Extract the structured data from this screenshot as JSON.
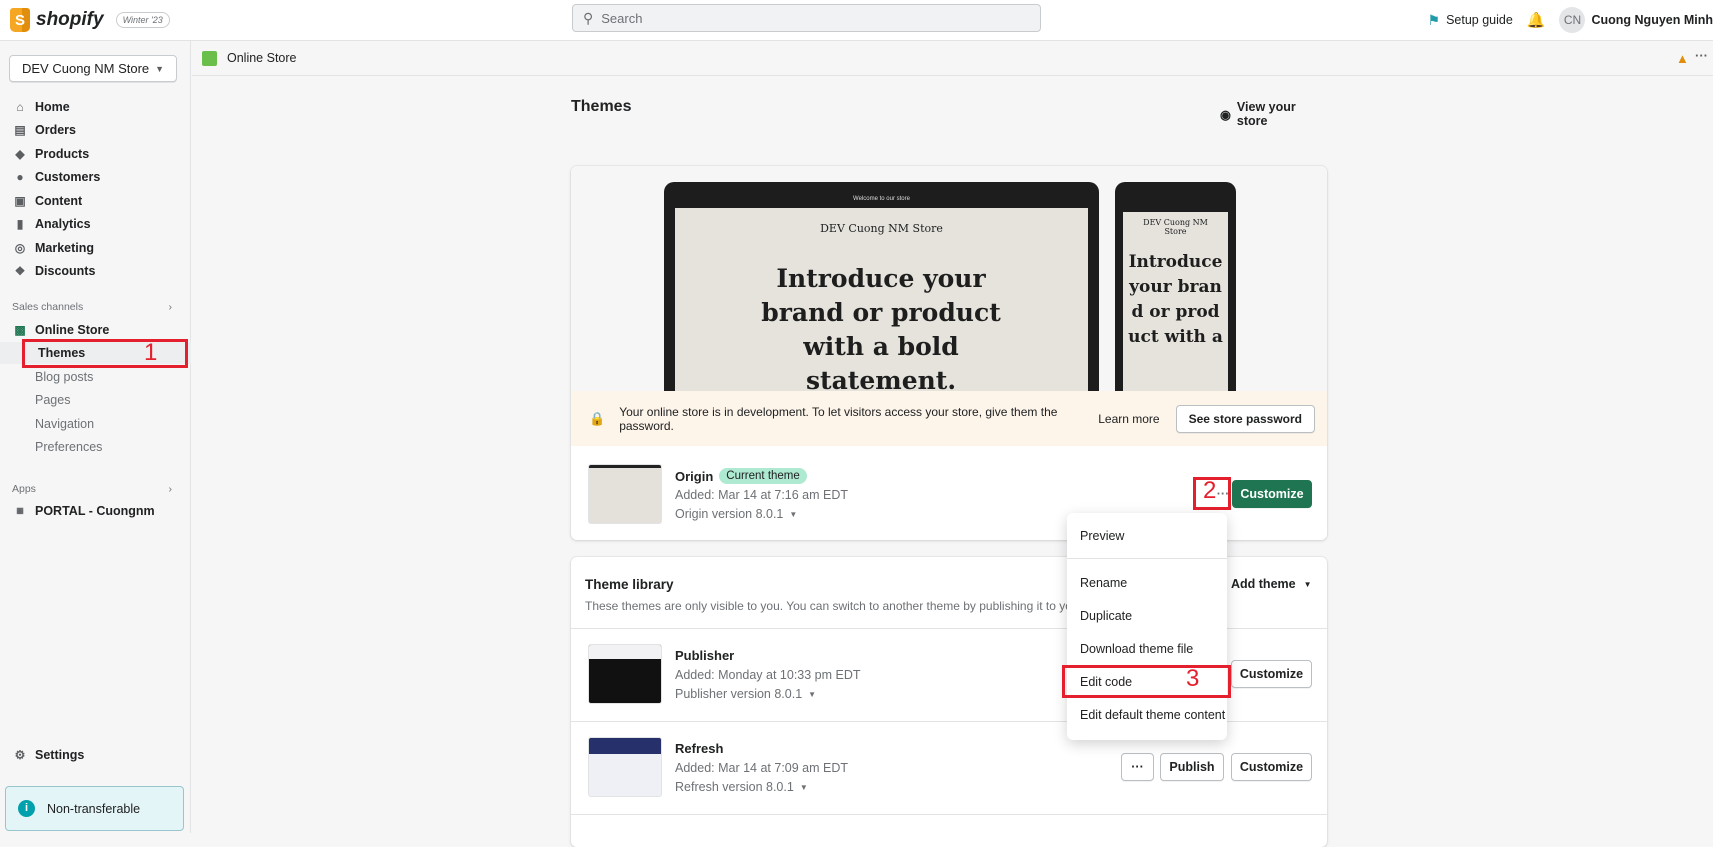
{
  "topbar": {
    "brand": "shopify",
    "version_badge": "Winter '23",
    "search_placeholder": "Search",
    "setup_guide": "Setup guide",
    "avatar_initials": "CN",
    "user_name": "Cuong Nguyen Minh"
  },
  "sidebar": {
    "store_name": "DEV Cuong NM Store",
    "nav": [
      {
        "label": "Home",
        "icon": "home-icon"
      },
      {
        "label": "Orders",
        "icon": "orders-icon"
      },
      {
        "label": "Products",
        "icon": "tag-icon"
      },
      {
        "label": "Customers",
        "icon": "person-icon"
      },
      {
        "label": "Content",
        "icon": "content-icon"
      },
      {
        "label": "Analytics",
        "icon": "chart-icon"
      },
      {
        "label": "Marketing",
        "icon": "target-icon"
      },
      {
        "label": "Discounts",
        "icon": "discount-icon"
      }
    ],
    "sales_channels_label": "Sales channels",
    "online_store": "Online Store",
    "sub_items": [
      "Themes",
      "Blog posts",
      "Pages",
      "Navigation",
      "Preferences"
    ],
    "apps_label": "Apps",
    "app_item": "PORTAL - Cuongnm",
    "settings": "Settings",
    "non_transferable": "Non-transferable"
  },
  "breadcrumb": {
    "label": "Online Store"
  },
  "page": {
    "title": "Themes",
    "view_store": "View your store"
  },
  "preview": {
    "announcement": "Welcome to our store",
    "store_title": "DEV Cuong NM Store",
    "store_title_mobile": "DEV Cuong NM Store",
    "headline": "Introduce your brand or product with a bold statement.",
    "headline_mobile": "Introduce your brand or product with a"
  },
  "banner": {
    "text": "Your online store is in development. To let visitors access your store, give them the password.",
    "learn_more": "Learn more",
    "button": "See store password"
  },
  "current_theme": {
    "name": "Origin",
    "badge": "Current theme",
    "added": "Added: Mar 14 at 7:16 am EDT",
    "version": "Origin version 8.0.1",
    "customize": "Customize"
  },
  "menu": {
    "items": [
      "Preview",
      "Rename",
      "Duplicate",
      "Download theme file",
      "Edit code",
      "Edit default theme content"
    ]
  },
  "library": {
    "title": "Theme library",
    "description": "These themes are only visible to you. You can switch to another theme by publishing it to your st",
    "add_theme": "Add theme",
    "themes": [
      {
        "name": "Publisher",
        "added": "Added: Monday at 10:33 pm EDT",
        "version": "Publisher version 8.0.1",
        "customize": "Customize"
      },
      {
        "name": "Refresh",
        "added": "Added: Mar 14 at 7:09 am EDT",
        "version": "Refresh version 8.0.1",
        "publish": "Publish",
        "customize": "Customize"
      }
    ]
  },
  "annotations": {
    "one": "1",
    "two": "2",
    "three": "3"
  },
  "colors": {
    "accent": "#1f7551",
    "annotation": "#e5202e",
    "banner_bg": "#fdf4ea",
    "badge_bg": "#aee9d1"
  }
}
